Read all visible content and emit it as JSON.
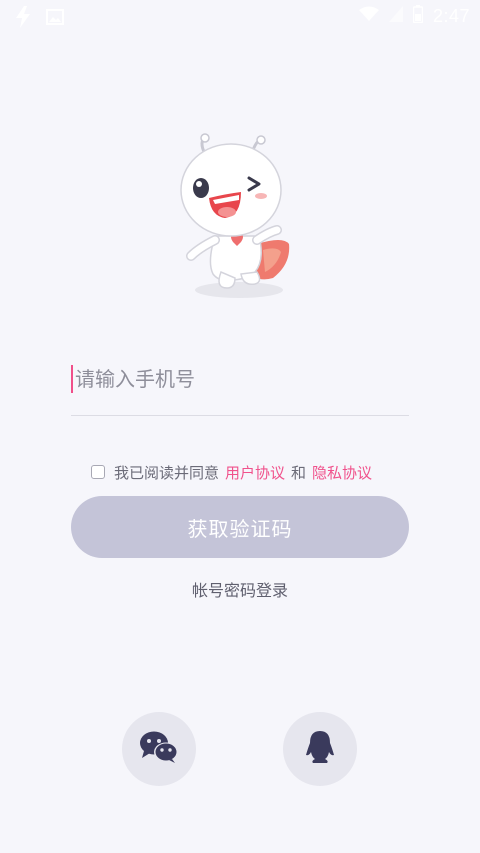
{
  "status_bar": {
    "time": "2:47",
    "icons": [
      "bolt-icon",
      "image-icon",
      "wifi-icon",
      "signal-icon",
      "battery-icon"
    ]
  },
  "colors": {
    "background": "#f6f6fb",
    "accent_pink": "#f0528c",
    "button_disabled": "#c4c4d8",
    "social_bg": "#e6e6ee",
    "icon_dark": "#3a3a5c"
  },
  "login": {
    "phone_placeholder": "请输入手机号",
    "phone_value": "",
    "agreement": {
      "checked": false,
      "prefix": "我已阅读并同意",
      "user_agreement": "用户协议",
      "conjunction": "和",
      "privacy_policy": "隐私协议"
    },
    "get_code_label": "获取验证码",
    "account_login_label": "帐号密码登录"
  },
  "social_login": {
    "items": [
      "wechat-icon",
      "qq-icon"
    ]
  }
}
